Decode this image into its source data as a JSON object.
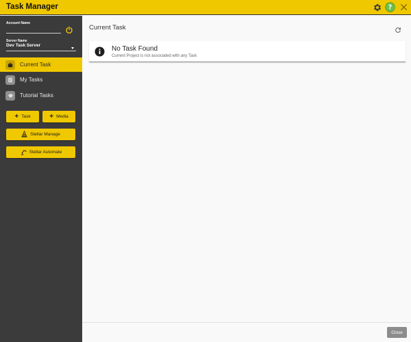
{
  "app": {
    "title": "Task Manager"
  },
  "colors": {
    "accent": "#f0c800",
    "sidebar_bg": "#3c3b3b",
    "main_bg": "#f9f9f9",
    "help_green": "#6cc04a"
  },
  "titlebar": {
    "icons": [
      "gear-icon",
      "help-icon",
      "close-icon"
    ]
  },
  "sidebar": {
    "account": {
      "label": "Account Name",
      "value": ""
    },
    "server": {
      "label": "Server Name",
      "value": "Dev Task Server"
    },
    "nav": [
      {
        "label": "Current Task",
        "icon": "briefcase-icon",
        "active": true
      },
      {
        "label": "My Tasks",
        "icon": "list-icon",
        "active": false
      },
      {
        "label": "Tutorial Tasks",
        "icon": "graduation-cap-icon",
        "active": false
      }
    ],
    "buttons": {
      "task": "Task",
      "media": "Media",
      "stellar_manage": "Stellar Manage",
      "stellar_automate": "Stellar Automate"
    }
  },
  "main": {
    "title": "Current Task",
    "notice": {
      "title": "No Task Found",
      "subtitle": "Current Project is not associated with any Task"
    }
  },
  "footer": {
    "close_label": "Close"
  }
}
